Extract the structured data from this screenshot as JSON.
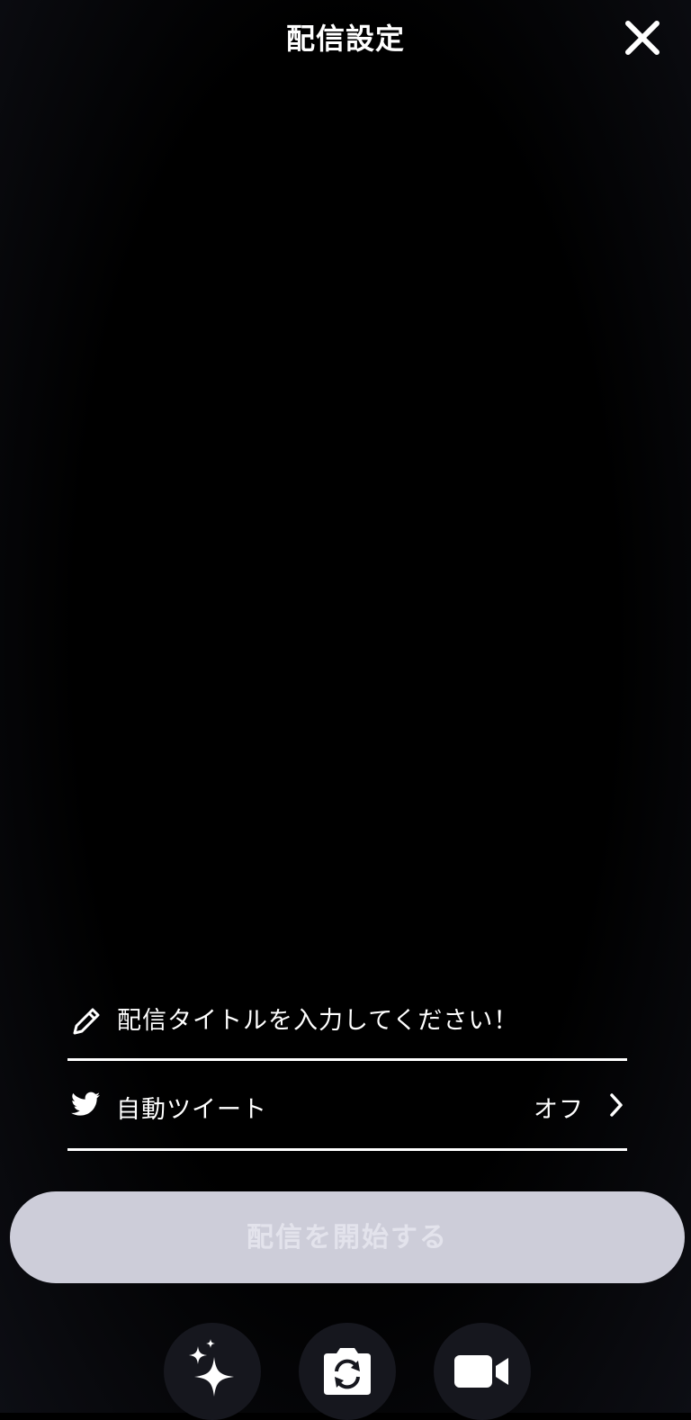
{
  "header": {
    "title": "配信設定",
    "close_icon": "close-icon"
  },
  "form": {
    "title_input": {
      "icon": "pencil-icon",
      "value": "",
      "placeholder": "配信タイトルを入力してください！"
    },
    "auto_tweet": {
      "icon": "twitter-bird-icon",
      "label": "自動ツイート",
      "value": "オフ",
      "chevron_icon": "chevron-right-icon"
    }
  },
  "start_button": {
    "label": "配信を開始する",
    "background": "#cdcdd9",
    "text_color": "#e3e3ec",
    "disabled": true
  },
  "bottom_controls": [
    {
      "name": "effects",
      "icon": "sparkles-icon"
    },
    {
      "name": "flip-camera",
      "icon": "camera-flip-icon"
    },
    {
      "name": "video",
      "icon": "video-camera-icon"
    }
  ],
  "colors": {
    "background": "#000000",
    "divider": "#ffffff",
    "control_bg": "#16171e"
  }
}
